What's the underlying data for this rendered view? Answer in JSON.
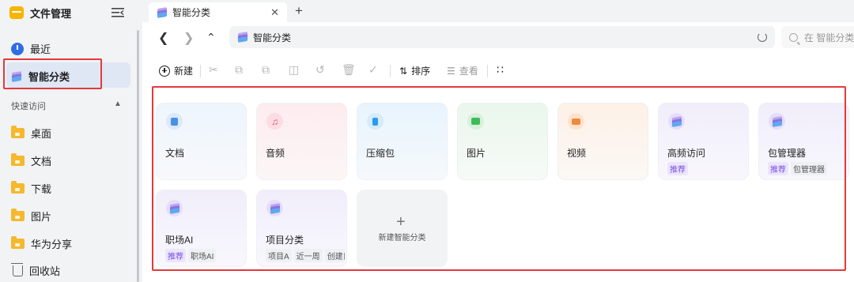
{
  "sidebar": {
    "app_title": "文件管理",
    "items": [
      {
        "label": "最近"
      },
      {
        "label": "智能分类"
      }
    ],
    "section_label": "快速访问",
    "quick_access": [
      {
        "label": "桌面"
      },
      {
        "label": "文档"
      },
      {
        "label": "下载"
      },
      {
        "label": "图片"
      },
      {
        "label": "华为分享"
      },
      {
        "label": "回收站"
      }
    ]
  },
  "tabs": [
    {
      "label": "智能分类"
    }
  ],
  "address": {
    "path": "智能分类"
  },
  "search": {
    "placeholder": "在 智能分类"
  },
  "toolbar": {
    "new_label": "新建",
    "sort_label": "排序",
    "view_label": "查看"
  },
  "categories": [
    {
      "label": "文档",
      "tags": []
    },
    {
      "label": "音频",
      "tags": []
    },
    {
      "label": "压缩包",
      "tags": []
    },
    {
      "label": "图片",
      "tags": []
    },
    {
      "label": "视频",
      "tags": []
    },
    {
      "label": "高频访问",
      "tags": [
        "推荐"
      ]
    },
    {
      "label": "包管理器",
      "tags": [
        "推荐",
        "包管理器"
      ]
    },
    {
      "label": "职场AI",
      "tags": [
        "推荐",
        "职场AI"
      ]
    },
    {
      "label": "项目分类",
      "tags": [
        "项目A",
        "近一周",
        "创建日"
      ]
    }
  ],
  "new_category_label": "新建智能分类",
  "colors": {
    "highlight_border": "#e5383b",
    "accent": "#2f6ce5"
  }
}
